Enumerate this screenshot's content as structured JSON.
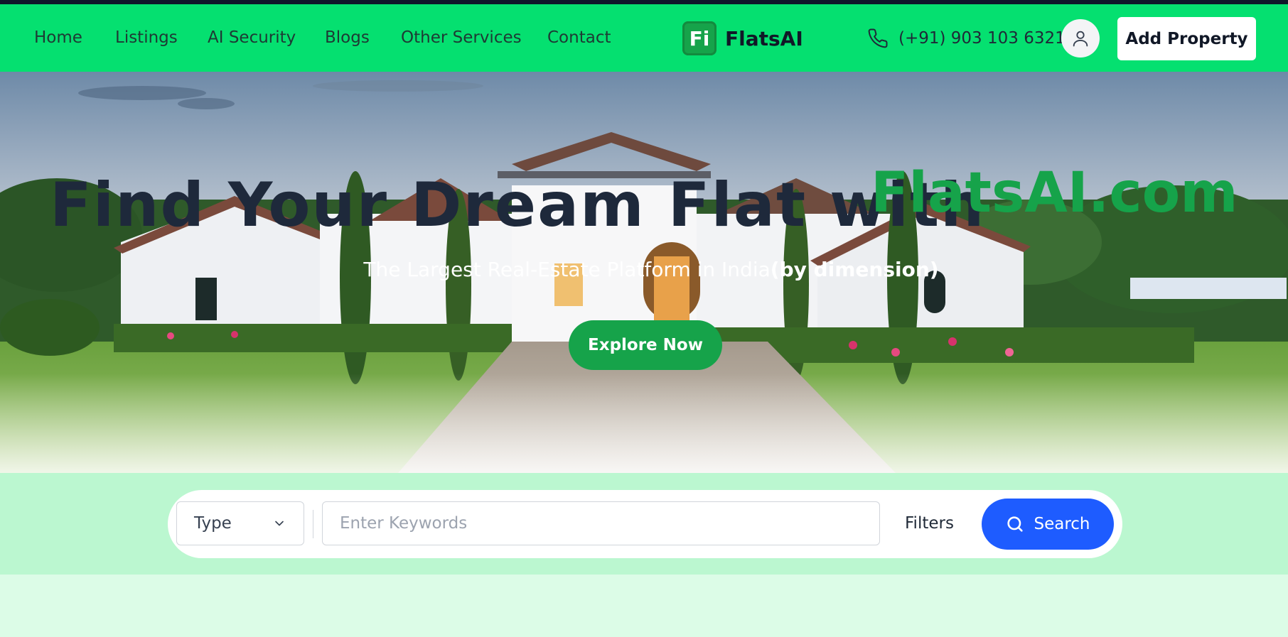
{
  "nav": {
    "links": [
      "Home",
      "Listings",
      "AI Security",
      "Blogs",
      "Other Services",
      "Contact"
    ],
    "brand_logo": "Fi",
    "brand_name": "FlatsAI",
    "phone": "(+91) 903 103 6321",
    "add_property": "Add Property"
  },
  "hero": {
    "headline_dark": "Find Your Dream Flat with",
    "headline_green": "FlatsAI.com",
    "subhead_plain": "The Largest Real-Estate Platform in India",
    "subhead_bold": "(by dimension)",
    "explore_label": "Explore Now"
  },
  "search": {
    "type_label": "Type",
    "keyword_placeholder": "Enter Keywords",
    "filters_label": "Filters",
    "search_label": "Search"
  },
  "colors": {
    "nav_bg": "#05e070",
    "accent_green": "#16a34a",
    "search_blue": "#1e5cff",
    "band_bg": "#bbf7d0"
  },
  "icons": [
    "phone-icon",
    "user-icon",
    "chevron-down-icon",
    "search-icon"
  ]
}
